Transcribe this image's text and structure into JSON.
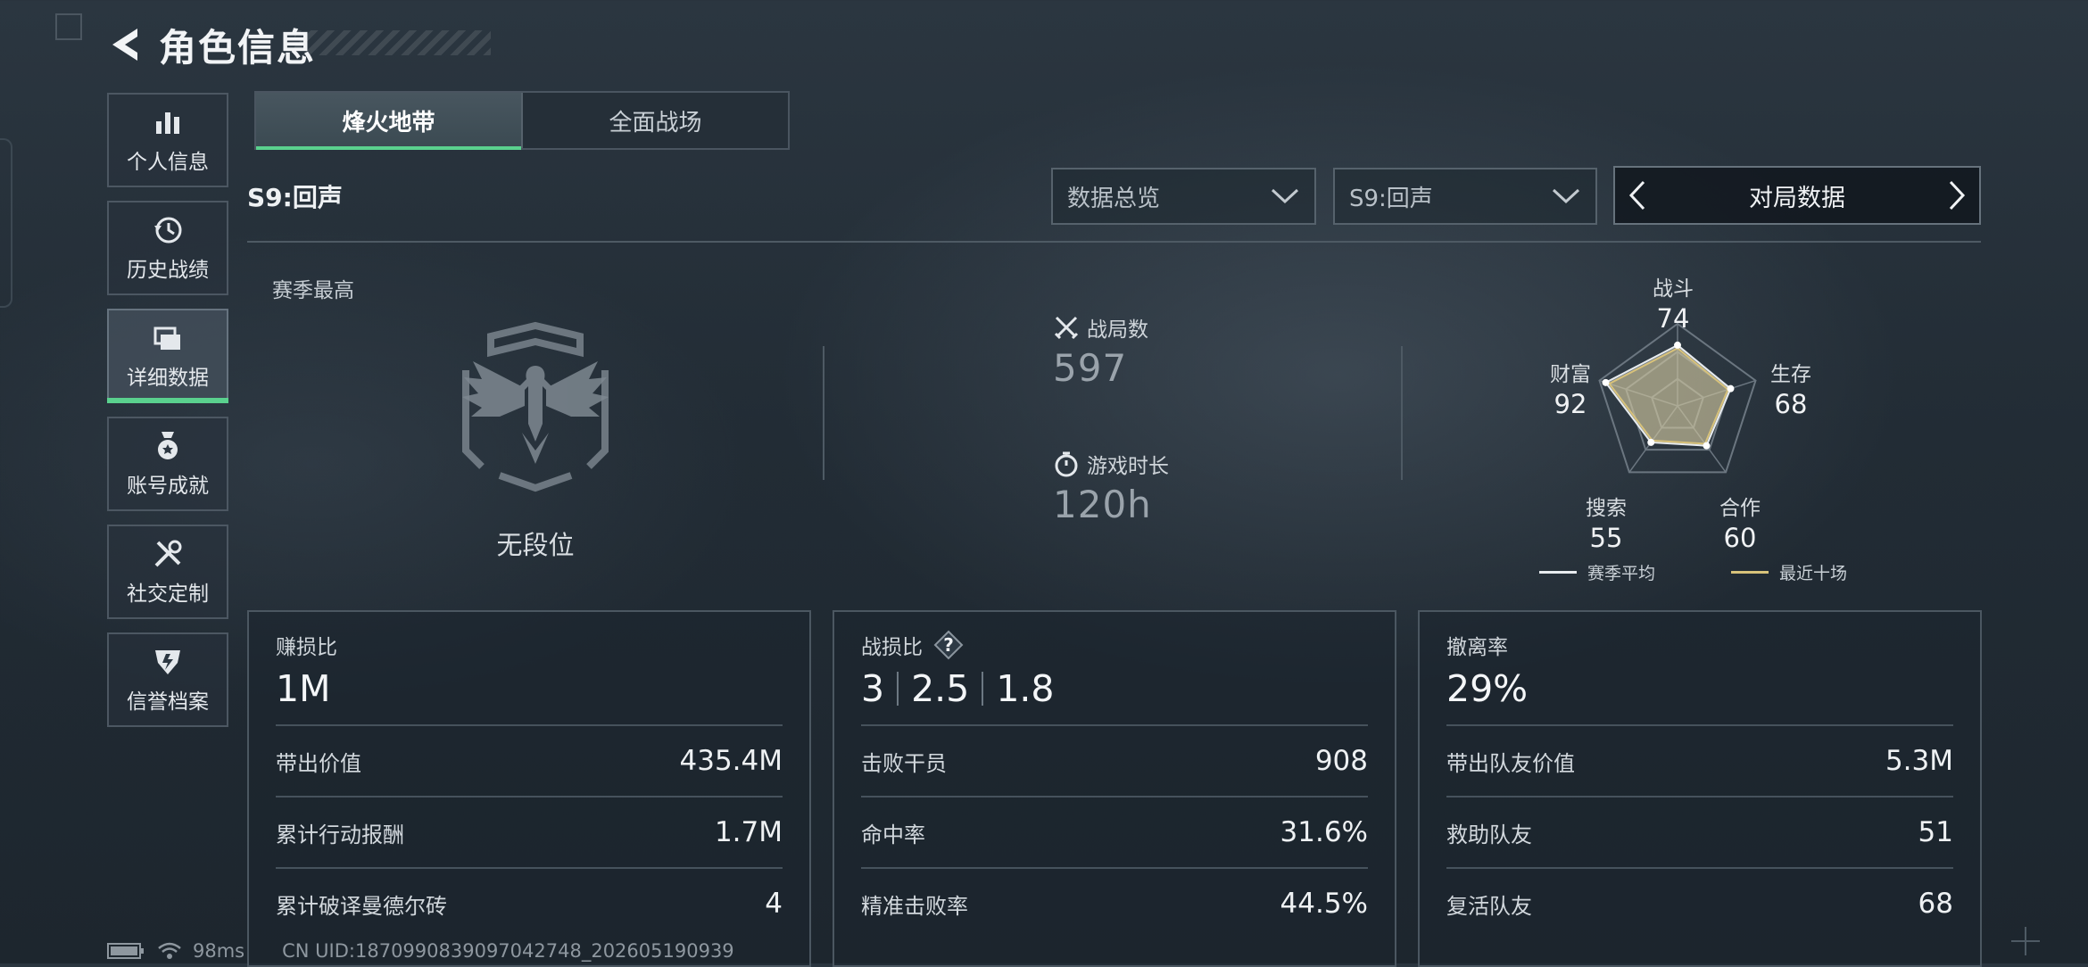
{
  "header": {
    "title": "角色信息"
  },
  "sidebar": {
    "items": [
      {
        "label": "个人信息",
        "icon": "bar-chart-icon",
        "active": false
      },
      {
        "label": "历史战绩",
        "icon": "history-clock-icon",
        "active": false
      },
      {
        "label": "详细数据",
        "icon": "folders-icon",
        "active": true
      },
      {
        "label": "账号成就",
        "icon": "medal-icon",
        "active": false
      },
      {
        "label": "社交定制",
        "icon": "tools-icon",
        "active": false
      },
      {
        "label": "信誉档案",
        "icon": "shield-badge-icon",
        "active": false
      }
    ]
  },
  "tabs": [
    {
      "label": "烽火地带",
      "active": true
    },
    {
      "label": "全面战场",
      "active": false
    }
  ],
  "season": {
    "label": "S9:回声"
  },
  "filters": {
    "overview": "数据总览",
    "season": "S9:回声",
    "switcher": "对局数据"
  },
  "top": {
    "season_best_label": "赛季最高",
    "rank_name": "无段位",
    "matches_label": "战局数",
    "matches_value": "597",
    "playtime_label": "游戏时长",
    "playtime_value": "120h"
  },
  "radar": {
    "axes": [
      {
        "label": "战斗",
        "value": "74"
      },
      {
        "label": "生存",
        "value": "68"
      },
      {
        "label": "合作",
        "value": "60"
      },
      {
        "label": "搜索",
        "value": "55"
      },
      {
        "label": "财富",
        "value": "92"
      }
    ],
    "legend_avg": "赛季平均",
    "legend_recent": "最近十场",
    "colors": {
      "avg": "#e8ecef",
      "recent": "#d8c27a"
    }
  },
  "cards": {
    "profit": {
      "title": "赚损比",
      "big": "1M",
      "rows": [
        {
          "label": "带出价值",
          "value": "435.4M"
        },
        {
          "label": "累计行动报酬",
          "value": "1.7M"
        },
        {
          "label": "累计破译曼德尔砖",
          "value": "4"
        }
      ]
    },
    "combat": {
      "title": "战损比",
      "help": "?",
      "ratios": [
        "3",
        "2.5",
        "1.8"
      ],
      "rows": [
        {
          "label": "击败干员",
          "value": "908"
        },
        {
          "label": "命中率",
          "value": "31.6%"
        },
        {
          "label": "精准击败率",
          "value": "44.5%"
        }
      ]
    },
    "extract": {
      "title": "撤离率",
      "big": "29%",
      "rows": [
        {
          "label": "带出队友价值",
          "value": "5.3M"
        },
        {
          "label": "救助队友",
          "value": "51"
        },
        {
          "label": "复活队友",
          "value": "68"
        }
      ]
    }
  },
  "footer": {
    "ping": "98ms",
    "uid": "CN UID:1870990839097042748_202605190939"
  },
  "accent": "#5ad18e"
}
